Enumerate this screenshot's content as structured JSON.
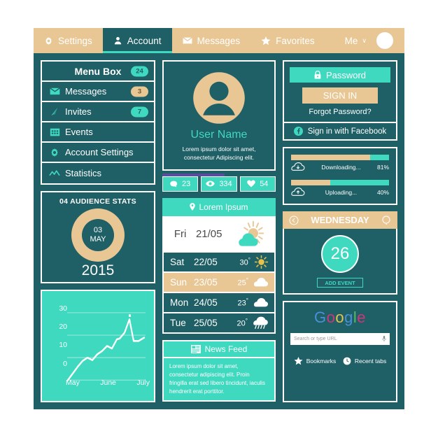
{
  "navbar": {
    "items": [
      {
        "label": "Settings",
        "icon": "gear-icon",
        "active": false
      },
      {
        "label": "Account",
        "icon": "user-icon",
        "active": true
      },
      {
        "label": "Messages",
        "icon": "envelope-icon",
        "active": false
      },
      {
        "label": "Favorites",
        "icon": "star-icon",
        "active": false
      }
    ],
    "me_label": "Me",
    "chevron": "∨"
  },
  "sidebar": {
    "items": [
      {
        "label": "Menu Box",
        "badge": "24",
        "badge_style": "teal",
        "icon": ""
      },
      {
        "label": "Messages",
        "badge": "3",
        "badge_style": "tan",
        "icon": "envelope-icon"
      },
      {
        "label": "Invites",
        "badge": "7",
        "badge_style": "teal",
        "icon": "paper-plane-icon"
      },
      {
        "label": "Events",
        "badge": "",
        "badge_style": "",
        "icon": "calendar-icon"
      },
      {
        "label": "Account Settings",
        "badge": "",
        "badge_style": "",
        "icon": "gear-icon"
      },
      {
        "label": "Statistics",
        "badge": "",
        "badge_style": "",
        "icon": "chart-line-icon"
      }
    ]
  },
  "audience_stats": {
    "title": "04 AUDIENCE STATS",
    "day": "03",
    "month": "MAY",
    "year": "2015"
  },
  "chart_data": {
    "type": "line",
    "title": "",
    "xlabel": "",
    "ylabel": "",
    "categories": [
      "May",
      "June",
      "July"
    ],
    "tick_labels_y": [
      "0",
      "10",
      "20",
      "30"
    ],
    "ylim": [
      0,
      32
    ],
    "grid": true,
    "legend": "none",
    "x": [
      0,
      1,
      2,
      3,
      4,
      5,
      6,
      7,
      8,
      9,
      10,
      11,
      12,
      13,
      14,
      15,
      16
    ],
    "values": [
      0,
      3,
      6,
      8.5,
      10,
      9,
      11.5,
      13,
      15,
      14,
      18,
      18.5,
      21,
      27,
      17.5,
      17.5,
      19
    ]
  },
  "profile": {
    "avatar_icon": "user-avatar-icon",
    "name": "User Name",
    "description": "Lorem ipsum dolor sit amet, consectetur Adipiscing elit.",
    "stats": [
      {
        "icon": "comment-icon",
        "value": "23"
      },
      {
        "icon": "eye-icon",
        "value": "334"
      },
      {
        "icon": "heart-icon",
        "value": "54"
      }
    ]
  },
  "weather": {
    "header": "Lorem Ipsum",
    "header_icon": "location-pin-icon",
    "today": {
      "day": "Fri",
      "date": "21/05",
      "icon": "sun-cloud-icon"
    },
    "forecast": [
      {
        "day": "Sat",
        "date": "22/05",
        "temp": "30",
        "unit": "°",
        "icon": "sun-icon",
        "highlight": false
      },
      {
        "day": "Sun",
        "date": "23/05",
        "temp": "25",
        "unit": "°",
        "icon": "cloud-icon",
        "highlight": true
      },
      {
        "day": "Mon",
        "date": "24/05",
        "temp": "23",
        "unit": "°",
        "icon": "cloud-icon",
        "highlight": false
      },
      {
        "day": "Tue",
        "date": "25/05",
        "temp": "20",
        "unit": "°",
        "icon": "rain-icon",
        "highlight": false
      }
    ]
  },
  "news_feed": {
    "title": "News Feed",
    "icon": "newspaper-icon",
    "body": "Lorem ipsum dolor sit amet, consectetur adipiscing elit. Proin fringilla erat sed libero tincidunt, iaculis hendrerit erat porttitor."
  },
  "login": {
    "password_label": "Password",
    "password_icon": "lock-icon",
    "signin_label": "SIGN IN",
    "forgot_label": "Forgot Password?",
    "facebook_label": "Sign in with Facebook",
    "facebook_icon": "facebook-icon"
  },
  "transfers": [
    {
      "label": "Downloading...",
      "percent": "81%",
      "value": 81,
      "icon": "cloud-download-icon"
    },
    {
      "label": "Uploading...",
      "percent": "40%",
      "value": 40,
      "icon": "cloud-upload-icon"
    }
  ],
  "calendar": {
    "title": "WEDNESDAY",
    "prev_icon": "chevron-left-icon",
    "next_icon": "chevron-right-icon",
    "day_number": "26",
    "add_event_label": "ADD EVENT"
  },
  "google": {
    "logo": [
      {
        "ch": "G",
        "color": "#4a90d9"
      },
      {
        "ch": "o",
        "color": "#d0347a"
      },
      {
        "ch": "o",
        "color": "#e8c24a"
      },
      {
        "ch": "g",
        "color": "#4a90d9"
      },
      {
        "ch": "l",
        "color": "#57bb63"
      },
      {
        "ch": "e",
        "color": "#d0347a"
      }
    ],
    "search_placeholder": "Search or type URL",
    "mic_icon": "microphone-icon",
    "bookmarks_label": "Bookmarks",
    "bookmarks_icon": "star-icon",
    "recent_label": "Recent tabs",
    "recent_icon": "clock-icon"
  },
  "colors": {
    "bg_dark": "#1f5f66",
    "teal": "#3fd9c0",
    "tan": "#e8c795",
    "white": "#ffffff",
    "purple": "#5b4b9c"
  }
}
